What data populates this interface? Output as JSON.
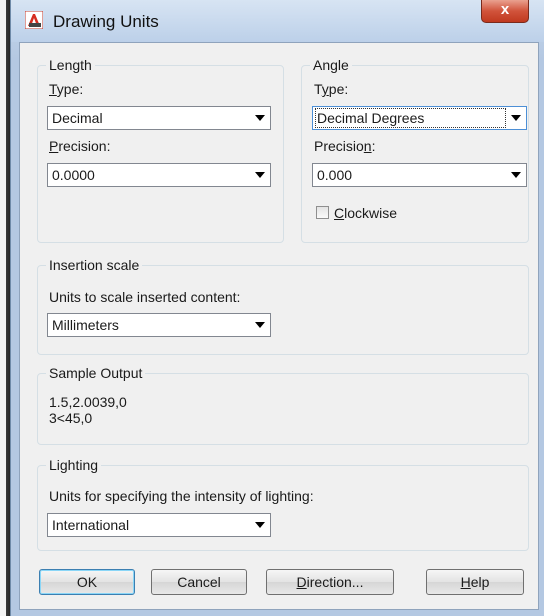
{
  "window": {
    "title": "Drawing Units",
    "close_glyph": "x"
  },
  "length": {
    "legend": "Length",
    "type_label": "Type:",
    "type_value": "Decimal",
    "precision_label": "Precision:",
    "precision_value": "0.0000"
  },
  "angle": {
    "legend": "Angle",
    "type_label": "Type:",
    "type_value": "Decimal Degrees",
    "precision_label": "Precision:",
    "precision_value": "0.000",
    "clockwise_label": "Clockwise",
    "clockwise_checked": false
  },
  "insertion": {
    "legend": "Insertion scale",
    "units_label": "Units to scale inserted content:",
    "units_value": "Millimeters"
  },
  "sample": {
    "legend": "Sample Output",
    "line1": "1.5,2.0039,0",
    "line2": "3<45,0"
  },
  "lighting": {
    "legend": "Lighting",
    "units_label": "Units for specifying the intensity of lighting:",
    "units_value": "International"
  },
  "buttons": {
    "ok": "OK",
    "cancel": "Cancel",
    "direction": "Direction...",
    "help": "Help"
  },
  "colors": {
    "close_button": "#c0391f",
    "dialog_bg": "#f0f0f0",
    "frame": "#b4c8e2"
  }
}
